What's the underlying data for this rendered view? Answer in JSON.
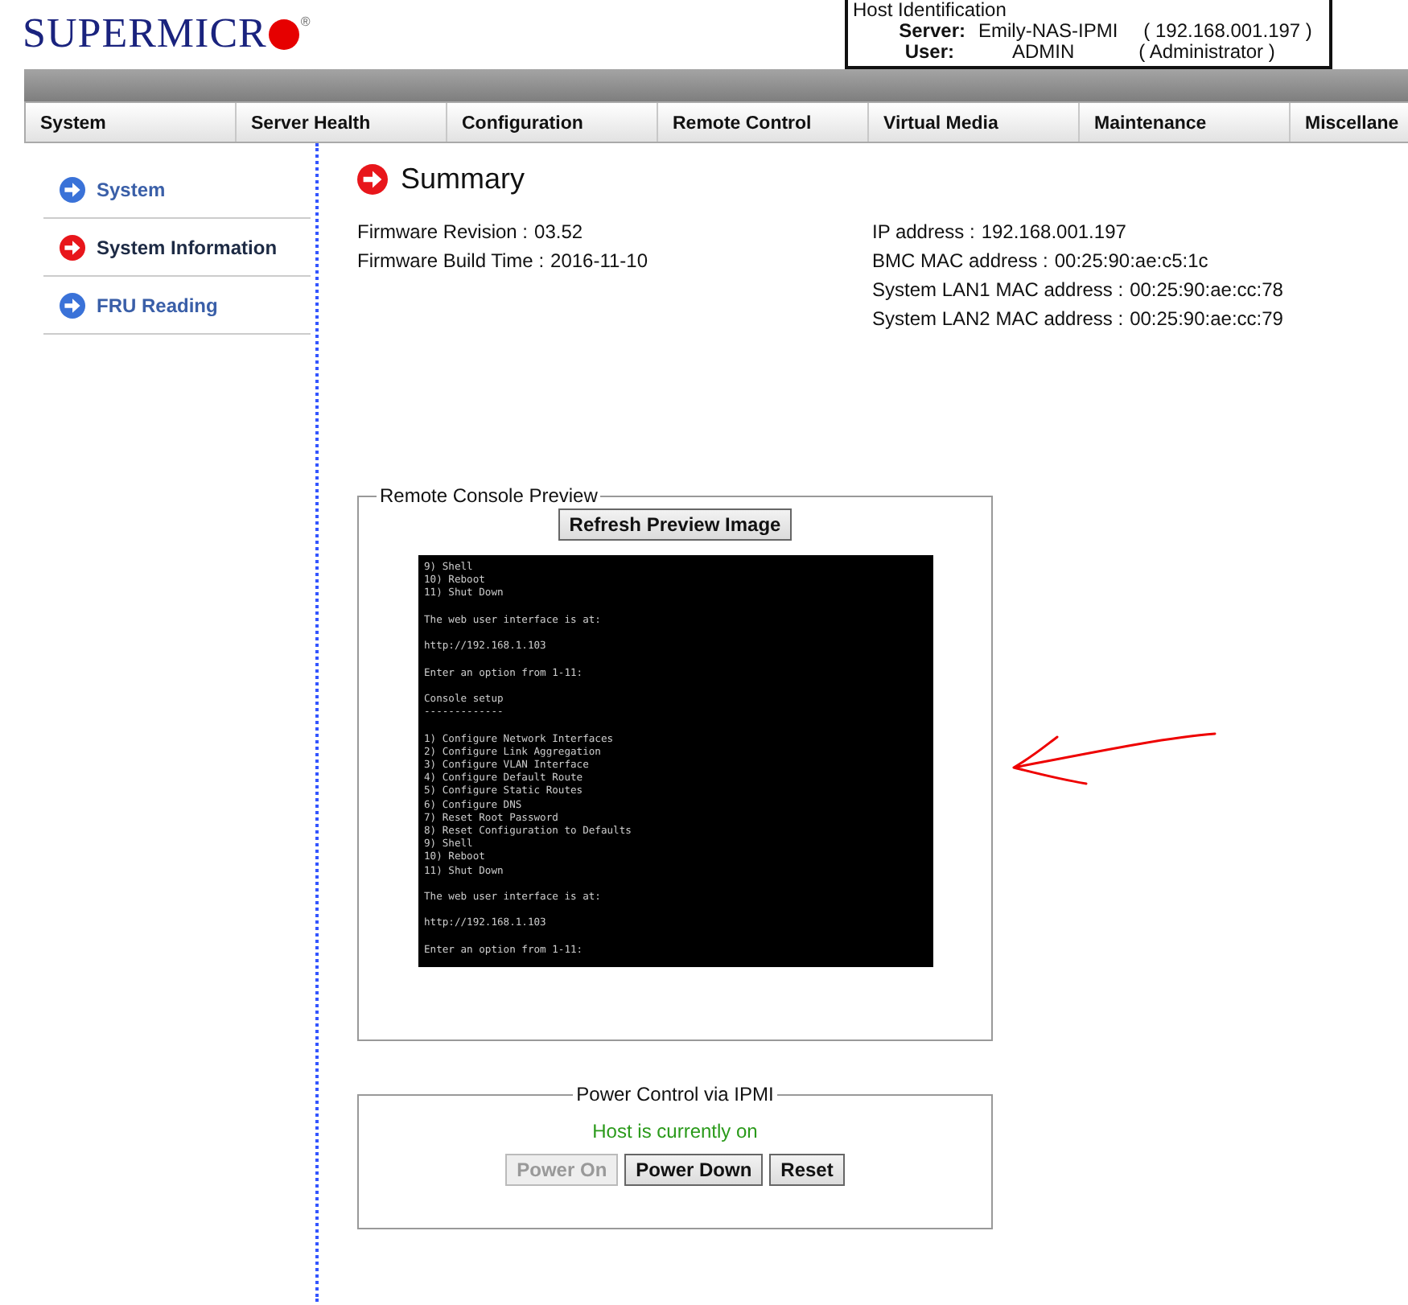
{
  "logo": {
    "text": "SUPERMICR",
    "mark": "®"
  },
  "host_identification": {
    "title": "Host Identification",
    "server_label": "Server:",
    "server_name": "Emily-NAS-IPMI",
    "server_ip": "( 192.168.001.197 )",
    "user_label": "User:",
    "user_name": "ADMIN",
    "user_role": "( Administrator )"
  },
  "menu": [
    "System",
    "Server Health",
    "Configuration",
    "Remote Control",
    "Virtual Media",
    "Maintenance",
    "Miscellane"
  ],
  "sidebar": {
    "items": [
      {
        "label": "System",
        "selected": false
      },
      {
        "label": "System Information",
        "selected": true
      },
      {
        "label": "FRU Reading",
        "selected": false
      }
    ]
  },
  "summary": {
    "title": "Summary",
    "left_fields": [
      {
        "label": "Firmware Revision :",
        "value": "03.52"
      },
      {
        "label": "Firmware Build Time :",
        "value": "2016-11-10"
      }
    ],
    "right_fields": [
      {
        "label": "IP address :",
        "value": "192.168.001.197"
      },
      {
        "label": "BMC MAC address :",
        "value": "00:25:90:ae:c5:1c"
      },
      {
        "label": "System LAN1 MAC address :",
        "value": "00:25:90:ae:cc:78"
      },
      {
        "label": "System LAN2 MAC address :",
        "value": "00:25:90:ae:cc:79"
      }
    ]
  },
  "remote_console": {
    "legend": "Remote Console Preview",
    "refresh_button": "Refresh Preview Image",
    "paragraphs": [
      [
        "9) Shell",
        "10) Reboot",
        "11) Shut Down"
      ],
      [
        "The web user interface is at:"
      ],
      [
        "http://192.168.1.103"
      ],
      [
        "Enter an option from 1-11:"
      ],
      [
        "Console setup",
        "-------------"
      ],
      [
        "1) Configure Network Interfaces",
        "2) Configure Link Aggregation",
        "3) Configure VLAN Interface",
        "4) Configure Default Route",
        "5) Configure Static Routes",
        "6) Configure DNS",
        "7) Reset Root Password",
        "8) Reset Configuration to Defaults",
        "9) Shell",
        "10) Reboot",
        "11) Shut Down"
      ],
      [
        "The web user interface is at:"
      ],
      [
        "http://192.168.1.103"
      ],
      [
        "Enter an option from 1-11:"
      ]
    ]
  },
  "power_control": {
    "legend": "Power Control via IPMI",
    "status": "Host is currently on",
    "host_on": true,
    "buttons": [
      {
        "label": "Power On",
        "disabled": true
      },
      {
        "label": "Power Down",
        "disabled": false
      },
      {
        "label": "Reset",
        "disabled": false
      }
    ]
  }
}
